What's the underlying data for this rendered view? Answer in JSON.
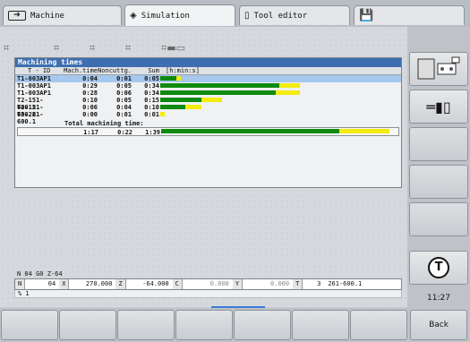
{
  "tabs": [
    {
      "label": "Machine",
      "icon": "arrow-right-icon"
    },
    {
      "label": "Simulation",
      "icon": "diamond-arrow-icon"
    },
    {
      "label": "Tool editor",
      "icon": "tool-editor-icon"
    },
    {
      "label": "",
      "icon": "save-disk-icon"
    }
  ],
  "window": {
    "title": "Machining times",
    "headers": {
      "id": "T - ID",
      "mach": "Mach.time",
      "noncut": "Noncuttg.",
      "sum": "Sum",
      "unit": "[h:min:s]"
    },
    "rows": [
      {
        "id": "T1-003AP1",
        "mach": "0:04",
        "noncut": "0:01",
        "sum": "0:05",
        "mach_frac": 0.04,
        "noncut_frac": 0.01
      },
      {
        "id": "T1-003AP1",
        "mach": "0:29",
        "noncut": "0:05",
        "sum": "0:34",
        "mach_frac": 0.29,
        "noncut_frac": 0.05
      },
      {
        "id": "T1-003AP1",
        "mach": "0:28",
        "noncut": "0:06",
        "sum": "0:34",
        "mach_frac": 0.28,
        "noncut_frac": 0.06
      },
      {
        "id": "T2-151-600.2",
        "mach": "0:10",
        "noncut": "0:05",
        "sum": "0:15",
        "mach_frac": 0.1,
        "noncut_frac": 0.05
      },
      {
        "id": "T2-151-600.2",
        "mach": "0:06",
        "noncut": "0:04",
        "sum": "0:10",
        "mach_frac": 0.06,
        "noncut_frac": 0.04
      },
      {
        "id": "T3-261-600.1",
        "mach": "0:00",
        "noncut": "0:01",
        "sum": "0:01",
        "mach_frac": 0.0,
        "noncut_frac": 0.01
      }
    ],
    "total_label": "Total machining time:",
    "total": {
      "mach": "1:17",
      "noncut": "0:22",
      "sum": "1:39",
      "mach_frac": 0.78,
      "noncut_frac": 0.22
    }
  },
  "status": {
    "line1": "N  04   G0 Z-64",
    "fields": [
      {
        "label": "N",
        "value": "04",
        "dim": false
      },
      {
        "label": "X",
        "value": "270.000",
        "dim": false
      },
      {
        "label": "Z",
        "value": "-64.000",
        "dim": false
      },
      {
        "label": "C",
        "value": "0.000",
        "dim": true
      },
      {
        "label": "Y",
        "value": "0.000",
        "dim": true
      },
      {
        "label": "T",
        "value": "3",
        "dim": false
      }
    ],
    "tool_name": "261-600.1",
    "line3": "% 1"
  },
  "clock": "11:27",
  "back_label": "Back",
  "colors": {
    "machining": "#0e8a0e",
    "noncutting": "#f2ec10",
    "title": "#3d6fb0",
    "selected_row": "#a6c8ee"
  }
}
